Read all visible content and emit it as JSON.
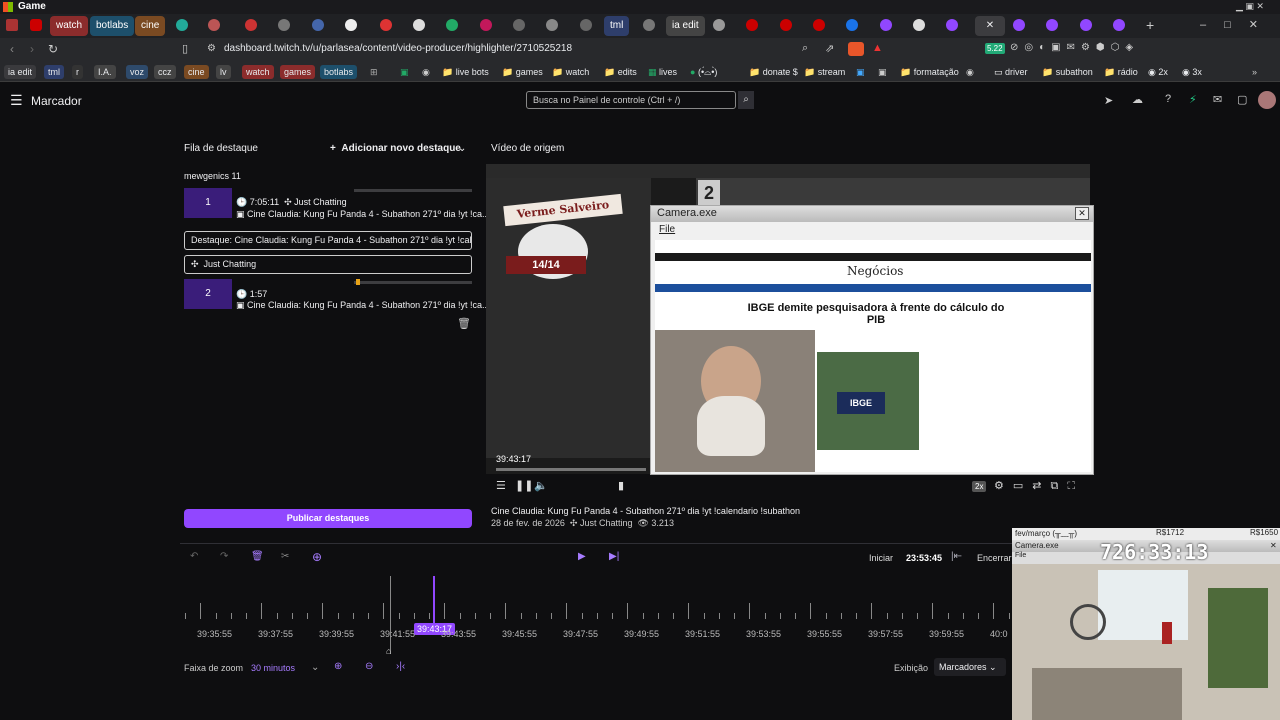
{
  "window": {
    "title": "Game"
  },
  "tabs": [
    {
      "label": "watch",
      "color": "#8b2c2c"
    },
    {
      "label": "botlabs",
      "color": "#1d4f6b"
    },
    {
      "label": "cine",
      "color": "#7a4a22"
    },
    {
      "label": "tml",
      "color": "#2e3e6b"
    },
    {
      "label": "ia edit",
      "color": "#444"
    }
  ],
  "nav": {
    "url": "dashboard.twitch.tv/u/parlasea/content/video-producer/highlighter/2710525218",
    "url_host": "dashboard.twitch.tv",
    "badge": "5.22"
  },
  "bookmarks": [
    "ia edit",
    "tml",
    "r",
    "I.A.",
    "voz",
    "ccz",
    "cine",
    "lv",
    "watch",
    "games",
    "botlabs",
    "live bots",
    "games",
    "watch",
    "edits",
    "lives",
    "(•́⌓•̀)",
    "donate $",
    "stream",
    "formatação",
    "driver",
    "subathon",
    "rádio",
    "2x",
    "3x"
  ],
  "header": {
    "section": "Marcador",
    "search_placeholder": "Busca no Painel de controle (Ctrl + /)"
  },
  "queue": {
    "title": "Fila de destaque",
    "add_label": "Adicionar novo destaque",
    "group": "mewgenics 11",
    "items": [
      {
        "num": "1",
        "time": "7:05:11",
        "category": "Just Chatting",
        "title": "Cine Claudia: Kung Fu Panda 4 - Subathon 271º dia !yt !ca..."
      },
      {
        "num": "2",
        "time": "1:57",
        "title": "Cine Claudia: Kung Fu Panda 4 - Subathon 271º dia !yt !ca..."
      }
    ],
    "edit_title": "Destaque: Cine Claudia: Kung Fu Panda 4 - Subathon 271º dia !yt !cal",
    "edit_category": "Just Chatting",
    "publish": "Publicar destaques"
  },
  "source": {
    "title": "Vídeo de origem",
    "overlay_name": "Verme Salveiro",
    "overlay_count": "14/14",
    "overlay_num": "2",
    "timestamp": "39:43:17",
    "speed": "2x",
    "video_title": "Cine Claudia: Kung Fu Panda 4 - Subathon 271º dia !yt !calendario !subathon",
    "date": "28 de fev. de 2026",
    "category": "Just Chatting",
    "views": "3.213",
    "cam_title": "Camera.exe",
    "cam_menu": "File",
    "news_brand": "Negócios",
    "headline": "IBGE demite pesquisadora à frente do cálculo do PIB",
    "logo": "IBGE"
  },
  "timeline": {
    "start_label": "Iniciar",
    "start_time": "23:53:45",
    "end_label": "Encerrar",
    "playhead": "39:43:17",
    "ticks": [
      "39:35:55",
      "39:37:55",
      "39:39:55",
      "39:41:55",
      "39:43:55",
      "39:45:55",
      "39:47:55",
      "39:49:55",
      "39:51:55",
      "39:53:55",
      "39:55:55",
      "39:57:55",
      "39:59:55",
      "40:0"
    ],
    "zoom_label": "Faixa de zoom",
    "zoom_value": "30 minutos",
    "view_label": "Exibição",
    "view_value": "Marcadores"
  },
  "webcam": {
    "date": "fev/março (╥﹏╥)",
    "price1": "R$1712",
    "price2": "R$1650",
    "cam_title": "Camera.exe",
    "cam_menu": "File",
    "counter": "726:33:13"
  }
}
